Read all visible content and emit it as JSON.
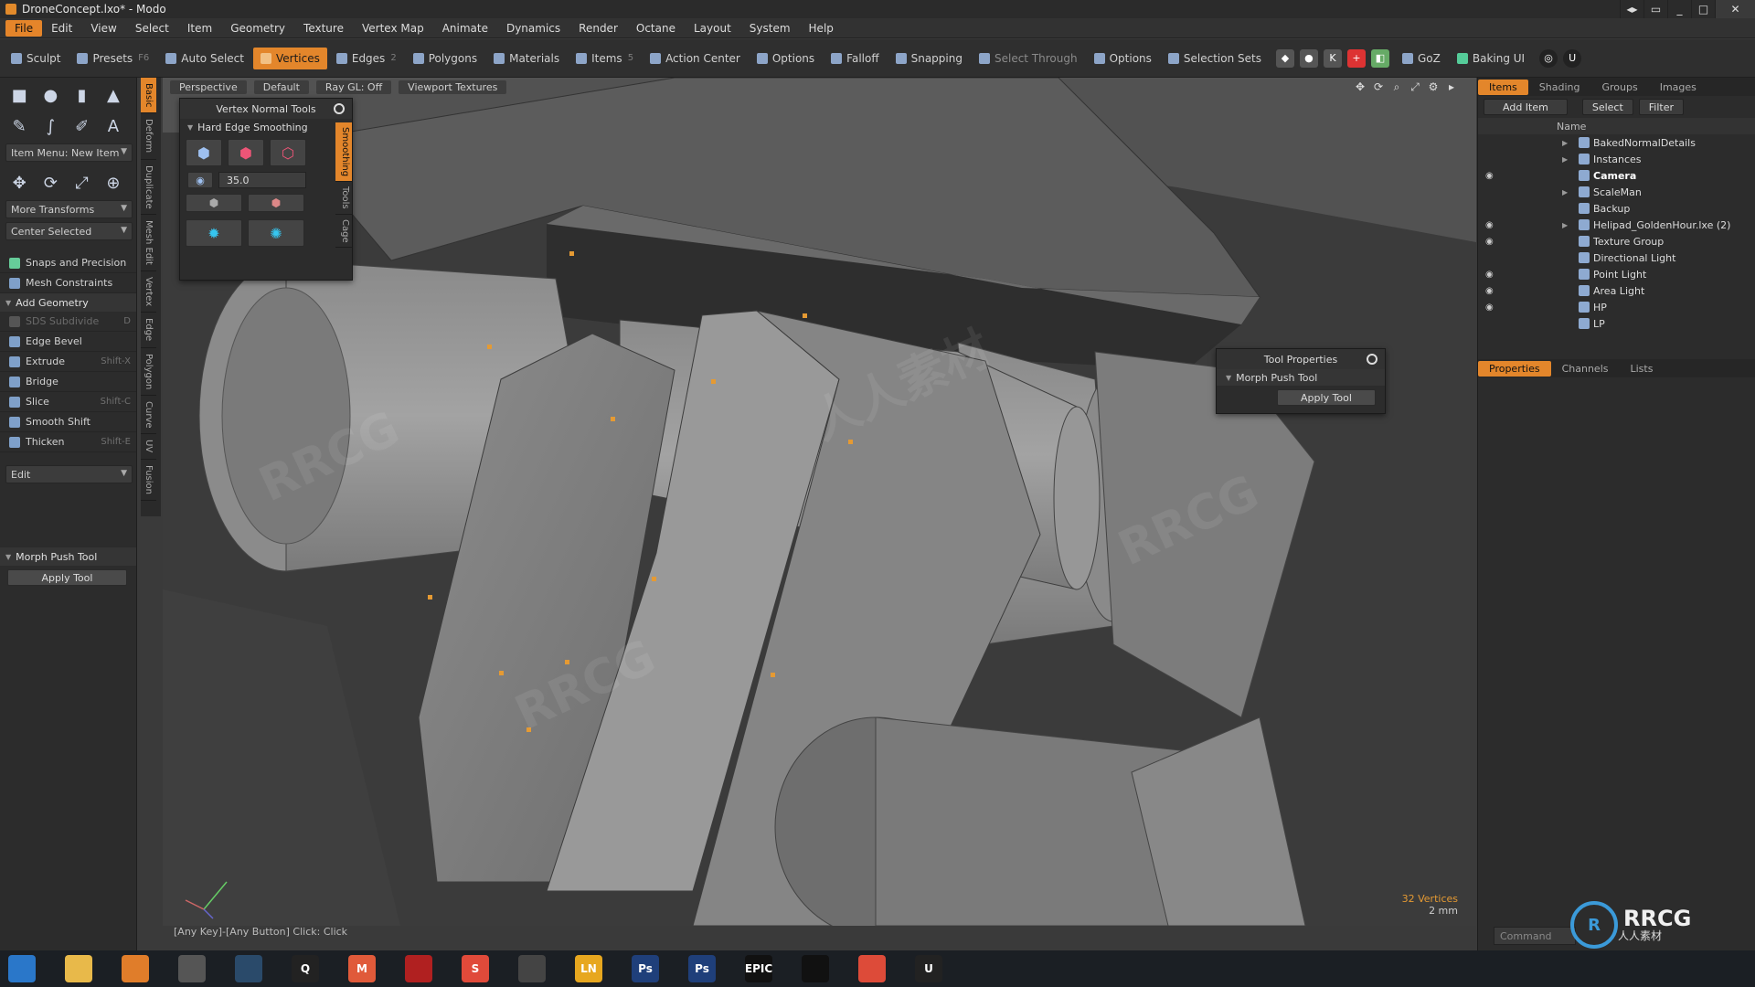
{
  "window": {
    "title": "DroneConcept.lxo* - Modo",
    "minimize": "_",
    "maximize": "□",
    "close": "✕",
    "extra1": "◂▸",
    "extra2": "▭"
  },
  "menu": [
    "File",
    "Edit",
    "View",
    "Select",
    "Item",
    "Geometry",
    "Texture",
    "Vertex Map",
    "Animate",
    "Dynamics",
    "Render",
    "Octane",
    "Layout",
    "System",
    "Help"
  ],
  "toolbar": {
    "sculpt": "Sculpt",
    "presets": "Presets",
    "presets_key": "F6",
    "auto_select": "Auto Select",
    "vertices": "Vertices",
    "edges": "Edges",
    "edges_key": "2",
    "polygons": "Polygons",
    "materials": "Materials",
    "items": "Items",
    "items_key": "5",
    "action_center": "Action Center",
    "options1": "Options",
    "falloff": "Falloff",
    "snapping": "Snapping",
    "select_through": "Select Through",
    "options2": "Options",
    "selection_sets": "Selection Sets",
    "goz": "GoZ",
    "baking_ui": "Baking UI"
  },
  "left": {
    "item_menu": "Item Menu: New Item",
    "more_transforms": "More Transforms",
    "center_selected": "Center Selected",
    "snaps": "Snaps and Precision",
    "mesh_constraints": "Mesh Constraints",
    "add_geometry": "Add Geometry",
    "tools": [
      {
        "label": "SDS Subdivide",
        "key": "D",
        "disabled": true
      },
      {
        "label": "Edge Bevel",
        "key": ""
      },
      {
        "label": "Extrude",
        "key": "Shift-X"
      },
      {
        "label": "Bridge",
        "key": ""
      },
      {
        "label": "Slice",
        "key": "Shift-C"
      },
      {
        "label": "Smooth Shift",
        "key": ""
      },
      {
        "label": "Thicken",
        "key": "Shift-E"
      }
    ],
    "edit": "Edit",
    "morph_push": "Morph Push Tool",
    "apply_tool": "Apply Tool"
  },
  "vtabs": [
    "Basic",
    "Deform",
    "Duplicate",
    "Mesh Edit",
    "Vertex",
    "Edge",
    "Polygon",
    "Curve",
    "UV",
    "Fusion"
  ],
  "viewport": {
    "perspective": "Perspective",
    "default": "Default",
    "raygl": "Ray GL: Off",
    "viewport_textures": "Viewport Textures",
    "vertex_count": "32 Vertices",
    "unit": "2 mm",
    "status": "[Any Key]-[Any Button] Click:  Click"
  },
  "vertex_normal_tools": {
    "title": "Vertex Normal Tools",
    "section": "Hard Edge Smoothing",
    "angle": "35.0",
    "tabs": [
      "Smoothing",
      "Tools",
      "Cage"
    ]
  },
  "tool_properties": {
    "title": "Tool Properties",
    "tool": "Morph Push Tool",
    "apply": "Apply Tool"
  },
  "right": {
    "tabs": [
      "Items",
      "Shading",
      "Groups",
      "Images"
    ],
    "add_item": "Add Item",
    "select": "Select",
    "filter": "Filter",
    "name_col": "Name",
    "items": [
      {
        "name": "BakedNormalDetails",
        "eye": false,
        "expand": true
      },
      {
        "name": "Instances",
        "eye": false,
        "expand": true
      },
      {
        "name": "Camera",
        "eye": true,
        "expand": false,
        "bold": true
      },
      {
        "name": "ScaleMan",
        "eye": false,
        "expand": true
      },
      {
        "name": "Backup",
        "eye": false,
        "expand": false
      },
      {
        "name": "Helipad_GoldenHour.lxe (2)",
        "eye": true,
        "expand": true
      },
      {
        "name": "Texture Group",
        "eye": true,
        "expand": false
      },
      {
        "name": "Directional Light",
        "eye": false,
        "expand": false
      },
      {
        "name": "Point Light",
        "eye": true,
        "expand": false
      },
      {
        "name": "Area Light",
        "eye": true,
        "expand": false
      },
      {
        "name": "HP",
        "eye": true,
        "expand": false
      },
      {
        "name": "LP",
        "eye": false,
        "expand": false
      }
    ],
    "lower_tabs": [
      "Properties",
      "Channels",
      "Lists"
    ],
    "command": "Command"
  },
  "taskbar": [
    {
      "name": "start-icon",
      "label": "",
      "color": "#2a77c9"
    },
    {
      "name": "file-explorer-icon",
      "label": "",
      "color": "#e8b94a"
    },
    {
      "name": "modo-icon",
      "label": "",
      "color": "#e07d2a"
    },
    {
      "name": "character-icon",
      "label": "",
      "color": "#555555"
    },
    {
      "name": "steam-icon",
      "label": "",
      "color": "#2a4a6a"
    },
    {
      "name": "app-q-icon",
      "label": "Q",
      "color": "#222222"
    },
    {
      "name": "marmoset-icon",
      "label": "M",
      "color": "#e05a3a"
    },
    {
      "name": "app-red-icon",
      "label": "",
      "color": "#b02020"
    },
    {
      "name": "substance-icon",
      "label": "S",
      "color": "#e04a3a"
    },
    {
      "name": "app-search-icon",
      "label": "",
      "color": "#444444"
    },
    {
      "name": "app-ln-icon",
      "label": "LN",
      "color": "#e7a71f"
    },
    {
      "name": "photoshop-icon-1",
      "label": "Ps",
      "color": "#1f3f7a"
    },
    {
      "name": "photoshop-icon-2",
      "label": "Ps",
      "color": "#1f3f7a"
    },
    {
      "name": "epic-games-icon",
      "label": "EPIC",
      "color": "#111111"
    },
    {
      "name": "app-black-icon",
      "label": "",
      "color": "#111111"
    },
    {
      "name": "chrome-icon",
      "label": "",
      "color": "#dd4b39"
    },
    {
      "name": "unreal-icon",
      "label": "U",
      "color": "#222222"
    }
  ],
  "watermark": "RRCG",
  "watermark_cn": "人人素材",
  "logo": {
    "title": "RRCG",
    "subtitle": "人人素材"
  },
  "colors": {
    "accent": "#e3862b",
    "viewport_bg": "#3b3b3b",
    "vertex": "#e59a33"
  }
}
